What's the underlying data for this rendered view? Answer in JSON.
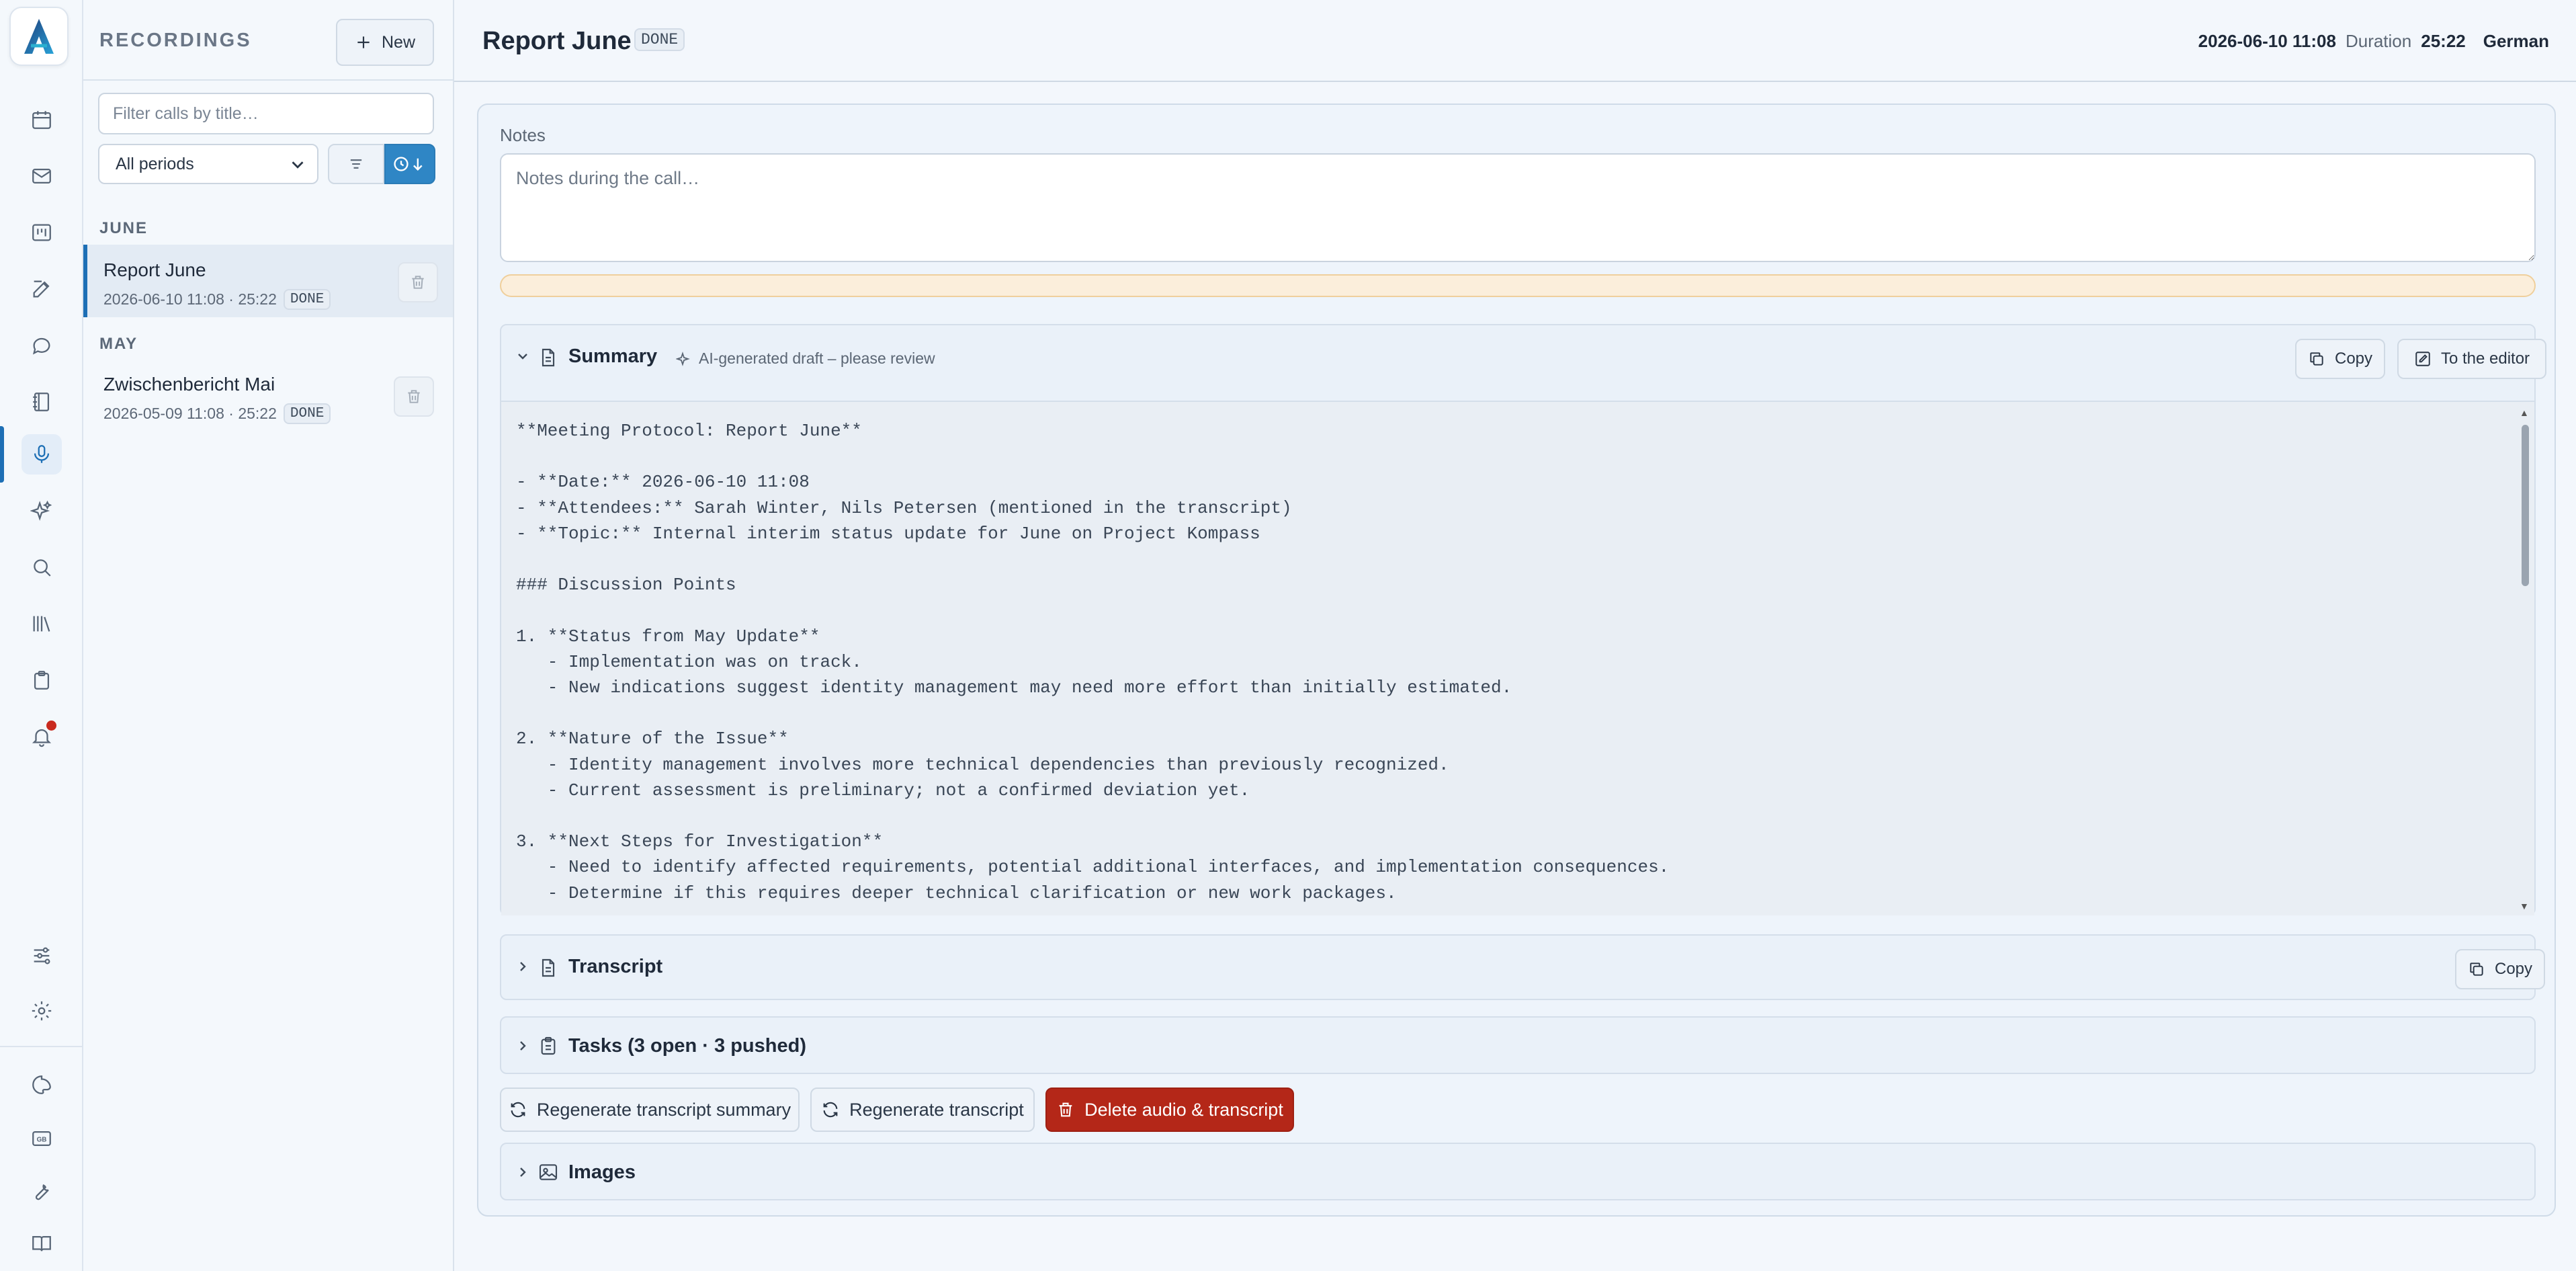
{
  "sidebar": {
    "nav_icons": [
      "calendar-icon",
      "mail-icon",
      "board-icon",
      "edit-icon",
      "chat-icon",
      "notebook-icon",
      "microphone-icon",
      "sparkle-icon",
      "search-icon",
      "library-icon",
      "clipboard-icon",
      "bell-icon",
      "sliders-icon",
      "gear-icon",
      "palette-icon",
      "gb-icon",
      "wrench-icon",
      "book-icon"
    ],
    "active_item": "microphone-icon",
    "notification_color": "#c92a1f"
  },
  "recordings": {
    "title": "RECORDINGS",
    "new_label": "New",
    "filter_placeholder": "Filter calls by title…",
    "period_value": "All periods",
    "groups": [
      {
        "label": "JUNE",
        "items": [
          {
            "name": "Report June",
            "meta": "2026-06-10 11:08 · 25:22",
            "status": "DONE",
            "active": true
          }
        ]
      },
      {
        "label": "MAY",
        "items": [
          {
            "name": "Zwischenbericht Mai",
            "meta": "2026-05-09 11:08 · 25:22",
            "status": "DONE",
            "active": false
          }
        ]
      }
    ]
  },
  "header": {
    "title": "Report June",
    "status": "DONE",
    "datetime": "2026-06-10 11:08",
    "duration_label": "Duration",
    "duration_value": "25:22",
    "language": "German"
  },
  "notes": {
    "label": "Notes",
    "placeholder": "Notes during the call…",
    "value": ""
  },
  "summary": {
    "title": "Summary",
    "ai_note": "AI-generated draft – please review",
    "copy_label": "Copy",
    "editor_label": "To the editor",
    "text": "**Meeting Protocol: Report June**\n\n- **Date:** 2026-06-10 11:08\n- **Attendees:** Sarah Winter, Nils Petersen (mentioned in the transcript)\n- **Topic:** Internal interim status update for June on Project Kompass\n\n### Discussion Points\n\n1. **Status from May Update**\n   - Implementation was on track.\n   - New indications suggest identity management may need more effort than initially estimated.\n\n2. **Nature of the Issue**\n   - Identity management involves more technical dependencies than previously recognized.\n   - Current assessment is preliminary; not a confirmed deviation yet.\n\n3. **Next Steps for Investigation**\n   - Need to identify affected requirements, potential additional interfaces, and implementation consequences.\n   - Determine if this requires deeper technical clarification or new work packages."
  },
  "transcript": {
    "title": "Transcript",
    "copy_label": "Copy"
  },
  "tasks": {
    "title": "Tasks (3 open · 3 pushed)"
  },
  "actions": {
    "regen_summary": "Regenerate transcript summary",
    "regen_transcript": "Regenerate transcript",
    "delete": "Delete audio & transcript"
  },
  "images": {
    "title": "Images"
  },
  "colors": {
    "accent": "#1d6fb5",
    "danger": "#b42718",
    "warning_bg": "#fbeedb"
  }
}
